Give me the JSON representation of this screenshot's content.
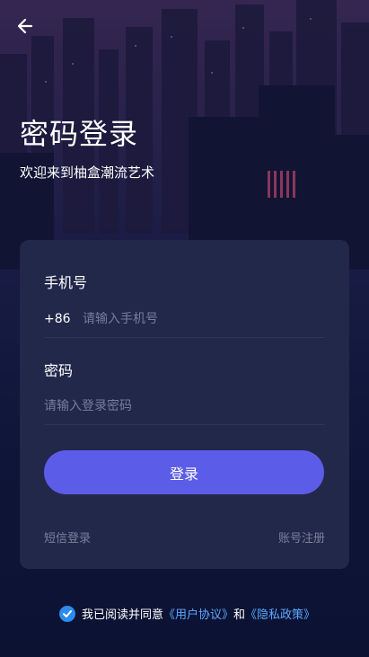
{
  "header": {
    "back_icon": "arrow-left-icon",
    "title": "密码登录",
    "subtitle": "欢迎来到柚盒潮流艺术"
  },
  "form": {
    "phone_label": "手机号",
    "phone_prefix": "+86",
    "phone_placeholder": "请输入手机号",
    "password_label": "密码",
    "password_placeholder": "请输入登录密码",
    "login_button": "登录",
    "sms_login_link": "短信登录",
    "register_link": "账号注册"
  },
  "agreement": {
    "checked": true,
    "check_icon": "checkmark-circle-icon",
    "text_prefix": "我已阅读并同意",
    "user_agreement": "《用户协议》",
    "conjunction": "和",
    "privacy_policy": "《隐私政策》"
  },
  "colors": {
    "accent": "#5b5de8",
    "link": "#5aa9ff",
    "card": "#22284a",
    "background": "#0d1233",
    "check": "#2d8bf0"
  }
}
